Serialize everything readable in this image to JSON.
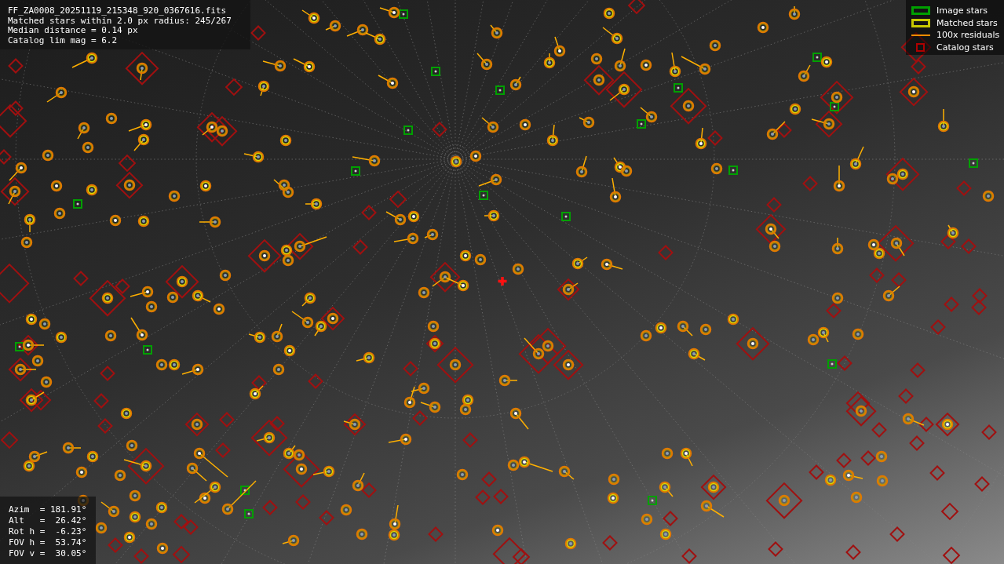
{
  "info_box": {
    "lines": [
      "FF_ZA0008_20251119_215348_920_0367616.fits",
      "Matched stars within 2.0 px radius: 245/267",
      "Median distance = 0.14 px",
      "Catalog lim mag = 6.2"
    ]
  },
  "legend": [
    {
      "kind": "image",
      "label": "Image stars",
      "color": "#00a000"
    },
    {
      "kind": "matched",
      "label": "Matched stars",
      "color": "#c8c800"
    },
    {
      "kind": "residual",
      "label": "100x residuals",
      "color": "#ff8c00"
    },
    {
      "kind": "catalog",
      "label": "Catalog stars",
      "color": "#b00000"
    }
  ],
  "pointing_box": {
    "lines": [
      "Azim  = 181.91°",
      "Alt   =  26.42°",
      "Rot h =  -6.23°",
      "FOV h =  53.74°",
      "FOV v =  30.05°"
    ]
  }
}
